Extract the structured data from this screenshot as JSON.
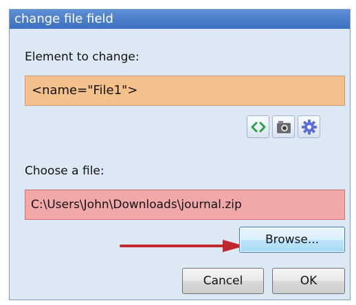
{
  "dialog": {
    "title": "change file field"
  },
  "element_section": {
    "label": "Element to change:",
    "value": "<name=\"File1\">"
  },
  "toolbar": {
    "icons": [
      "code-brackets-icon",
      "camera-icon",
      "gear-icon"
    ]
  },
  "file_section": {
    "label": "Choose a file:",
    "value": "C:\\Users\\John\\Downloads\\journal.zip"
  },
  "buttons": {
    "browse": "Browse...",
    "cancel": "Cancel",
    "ok": "OK"
  },
  "colors": {
    "title_bar": "#4a7cc8",
    "element_field": "#f4c08b",
    "file_field": "#f3a8a8",
    "arrow": "#c0282d"
  }
}
